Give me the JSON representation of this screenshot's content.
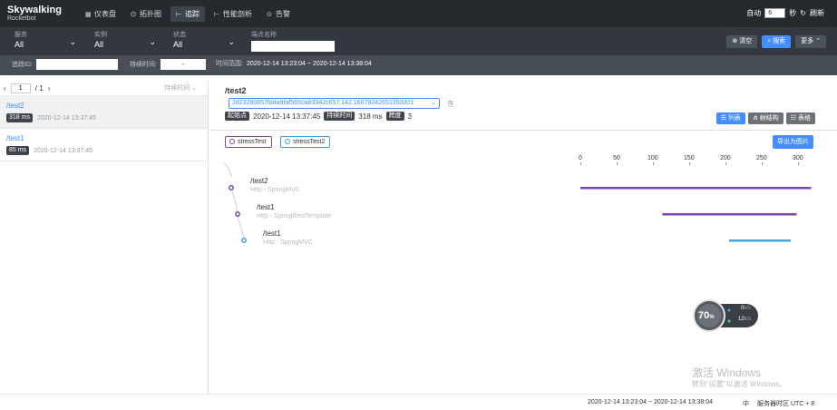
{
  "topbar": {
    "logo_line1": "Skywalking",
    "logo_line2": "Rocketbot",
    "nav": [
      {
        "label": "仪表盘",
        "icon": "dashboard-icon",
        "glyph": "▦"
      },
      {
        "label": "拓扑图",
        "icon": "topology-icon",
        "glyph": "⌬"
      },
      {
        "label": "追踪",
        "icon": "trace-icon",
        "glyph": "⊢"
      },
      {
        "label": "性能剖析",
        "icon": "profile-icon",
        "glyph": "⊢"
      },
      {
        "label": "告警",
        "icon": "alarm-icon",
        "glyph": "⊙"
      }
    ],
    "auto_label": "自动",
    "auto_value": "6",
    "seconds_label": "秒",
    "refresh_label": "刷新"
  },
  "filters": {
    "service_label": "服务",
    "service_value": "All",
    "instance_label": "实例",
    "instance_value": "All",
    "status_label": "状态",
    "status_value": "All",
    "endpoint_label": "端点名称",
    "endpoint_value": "",
    "clear_label": "清空",
    "search_label": "搜索",
    "more_label": "更多",
    "trace_id_label": "追踪ID:",
    "duration_label": "持续时间:",
    "duration_sep": "-",
    "time_range_label": "时间范围:",
    "time_range_value": "2020-12-14 13:23:04 ~ 2020-12-14 13:38:04"
  },
  "list": {
    "page": "1",
    "page_total": "/ 1",
    "sort_label": "持续时间 ⌄",
    "traces": [
      {
        "endpoint": "/test2",
        "duration": "318 ms",
        "time": "2020-12-14 13:37:45"
      },
      {
        "endpoint": "/test1",
        "duration": "85 ms",
        "time": "2020-12-14 13:37:45"
      }
    ]
  },
  "detail": {
    "title": "/test2",
    "trace_id": "2d23290657fd4a9faf5650a83342c657.142.16079242651350001",
    "start_label": "起始点",
    "start_value": "2020-12-14 13:37:45",
    "duration_label": "持续时间",
    "duration_value": "318 ms",
    "span_label": "跨度",
    "span_value": "3",
    "view_list": "列表",
    "view_tree": "树结构",
    "view_table": "表格",
    "services": [
      {
        "name": "stressTest",
        "color": "#7d47a8"
      },
      {
        "name": "stressTest2",
        "color": "#3fa5d9"
      }
    ],
    "export_label": "导出为图片",
    "ticks": [
      "0",
      "50",
      "100",
      "150",
      "200",
      "250",
      "300"
    ]
  },
  "chart_data": {
    "type": "gantt",
    "x_ticks": [
      0,
      50,
      100,
      150,
      200,
      250,
      300
    ],
    "spans": [
      {
        "endpoint": "/test2",
        "component": "Http - SpringMVC",
        "start": 0,
        "end": 318,
        "color": "#7d47a8"
      },
      {
        "endpoint": "/test1",
        "component": "Http - SpringRestTemplate",
        "start": 113,
        "end": 298,
        "color": "#7d47a8"
      },
      {
        "endpoint": "/test1",
        "component": "Http - SpringMVC",
        "start": 205,
        "end": 290,
        "color": "#3fa5d9"
      }
    ]
  },
  "widget": {
    "percent": "70",
    "percent_sign": "%",
    "up": "0",
    "down": "12",
    "unit": "k/s"
  },
  "watermark": {
    "line1": "激活 Windows",
    "line2": "转到\"设置\"以激活 Windows。"
  },
  "footer": {
    "time_range": "2020-12-14 13:23:04 ~ 2020-12-14 13:38:04",
    "lang": "中",
    "timezone": "服务器时区 UTC + 8"
  }
}
